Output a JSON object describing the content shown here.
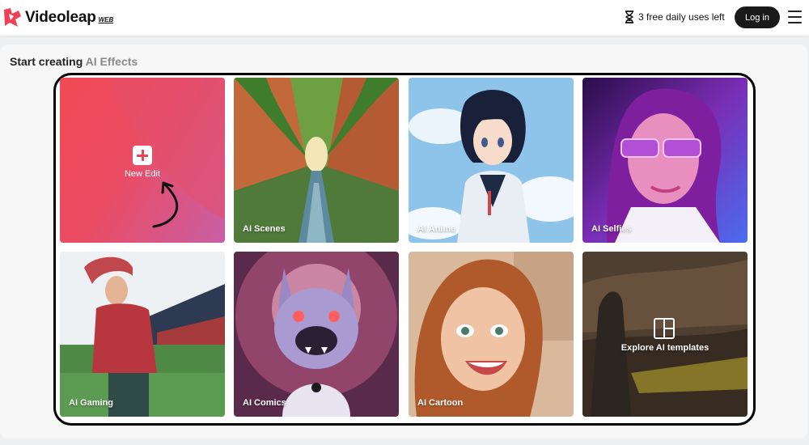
{
  "brand": {
    "name": "Videoleap",
    "tag": "WEB"
  },
  "header": {
    "uses_text": "3 free daily uses left",
    "login_label": "Log in"
  },
  "section": {
    "title_main": "Start creating ",
    "title_muted": "AI Effects"
  },
  "cards": {
    "new_edit": "New Edit",
    "scenes": "AI Scenes",
    "anime": "AI Anime",
    "selfies": "AI Selfies",
    "gaming": "AI Gaming",
    "comics": "AI Comics",
    "cartoon": "AI Cartoon",
    "explore": "Explore AI templates"
  },
  "colors": {
    "accent": "#e8455a",
    "frame": "#000000",
    "login_bg": "#1a1a1a"
  },
  "icons": [
    "videoleap-logo-icon",
    "hourglass-icon",
    "menu-icon",
    "plus-icon",
    "arrow-icon",
    "templates-icon"
  ]
}
